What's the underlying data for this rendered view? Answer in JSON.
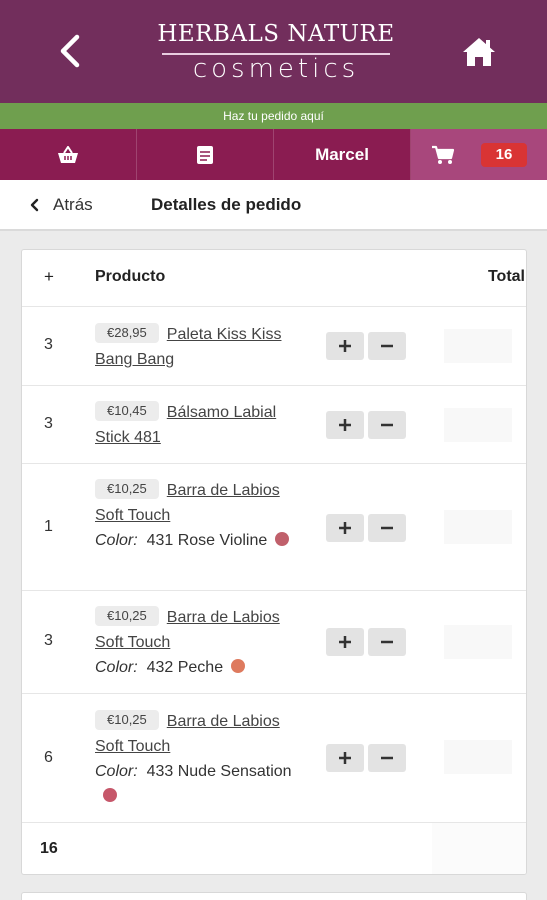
{
  "header": {
    "brand_top": "HERBALS NATURE",
    "brand_bottom": "cosmetics",
    "back_icon": "chevron-left-icon",
    "home_icon": "home-icon"
  },
  "banner": {
    "text": "Haz tu pedido aquí"
  },
  "navbar": {
    "shop_icon": "basket-icon",
    "orders_icon": "document-icon",
    "user_label": "Marcel",
    "cart_icon": "cart-icon",
    "cart_count": "16"
  },
  "subheader": {
    "back_label": "Atrás",
    "title": "Detalles de pedido"
  },
  "table": {
    "col_plus": "+",
    "col_product": "Producto",
    "col_total": "Total",
    "rows": [
      {
        "qty": "3",
        "price": "€28,95",
        "name": "Paleta Kiss Kiss Bang Bang"
      },
      {
        "qty": "3",
        "price": "€10,45",
        "name": "Bálsamo Labial Stick 481"
      },
      {
        "qty": "1",
        "price": "€10,25",
        "name": "Barra de Labios Soft Touch",
        "color_label": "Color:",
        "color_value": "431 Rose Violine",
        "swatch": "#c0606b"
      },
      {
        "qty": "3",
        "price": "€10,25",
        "name": "Barra de Labios Soft Touch",
        "color_label": "Color:",
        "color_value": "432 Peche",
        "swatch": "#de7a5e"
      },
      {
        "qty": "6",
        "price": "€10,25",
        "name": "Barra de Labios Soft Touch",
        "color_label": "Color:",
        "color_value": "433 Nude Sensation",
        "swatch": "#c6576a"
      }
    ],
    "footer_qty": "16"
  },
  "colors": {
    "header": "#722e5c",
    "banner": "#6f9f4e",
    "navbar": "#8a1c51",
    "cart_tab": "#a8477c",
    "badge": "#d93434"
  }
}
